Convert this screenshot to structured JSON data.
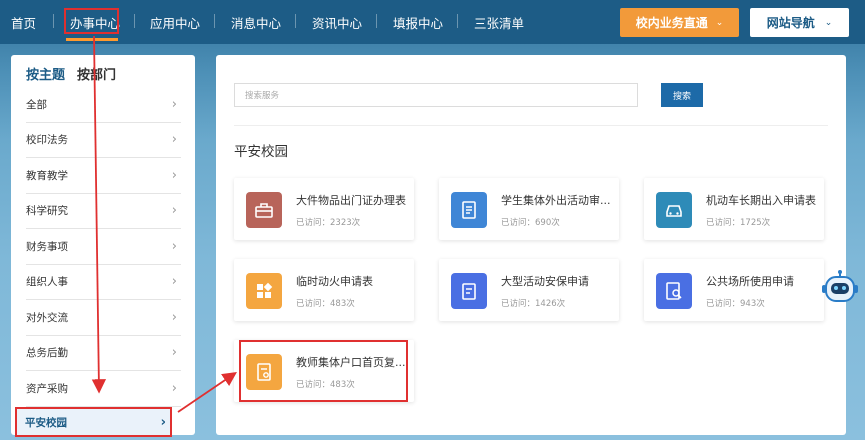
{
  "nav": {
    "items": [
      "首页",
      "办事中心",
      "应用中心",
      "消息中心",
      "资讯中心",
      "填报中心",
      "三张清单"
    ],
    "active_index": 1,
    "internal_button": "校内业务直通",
    "site_nav_button": "网站导航"
  },
  "sidebar": {
    "tabs": [
      "按主题",
      "按部门"
    ],
    "active_tab": 0,
    "items": [
      "全部",
      "校印法务",
      "教育教学",
      "科学研究",
      "财务事项",
      "组织人事",
      "对外交流",
      "总务后勤",
      "资产采购"
    ],
    "selected_item": "平安校园"
  },
  "main": {
    "search_placeholder": "搜索服务",
    "search_button": "搜索",
    "section_title": "平安校园",
    "cards": [
      {
        "title": "大件物品出门证办理表",
        "visits": "已访问：2323次",
        "icon": "toolbox-icon",
        "color": "#b8645a"
      },
      {
        "title": "学生集体外出活动审...",
        "visits": "已访问：690次",
        "icon": "form-icon",
        "color": "#3f86d6"
      },
      {
        "title": "机动车长期出入申请表",
        "visits": "已访问：1725次",
        "icon": "car-icon",
        "color": "#2e8bb8"
      },
      {
        "title": "临时动火申请表",
        "visits": "已访问：483次",
        "icon": "apps-icon",
        "color": "#f4a640"
      },
      {
        "title": "大型活动安保申请",
        "visits": "已访问：1426次",
        "icon": "edit-doc-icon",
        "color": "#4a6fe3"
      },
      {
        "title": "公共场所使用申请",
        "visits": "已访问：943次",
        "icon": "search-doc-icon",
        "color": "#4a6fe3"
      },
      {
        "title": "教师集体户口首页复...",
        "visits": "已访问：483次",
        "icon": "certificate-icon",
        "color": "#f4a640"
      }
    ]
  },
  "colors": {
    "accent": "#1d5c86",
    "highlight": "#e03030",
    "orange": "#f29a3a"
  }
}
